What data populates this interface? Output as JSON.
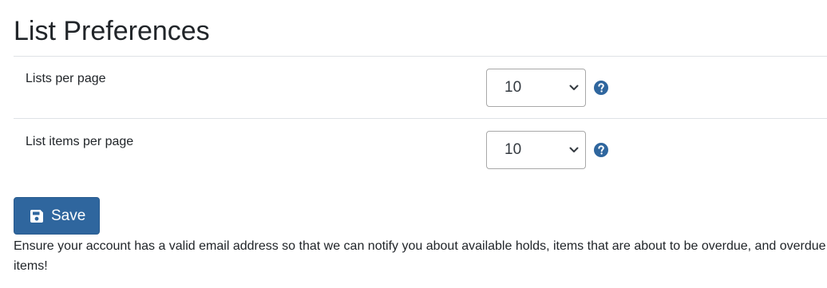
{
  "page": {
    "title": "List Preferences"
  },
  "preferences": [
    {
      "label": "Lists per page",
      "selected_value": "10",
      "help_icon": "question-circle-icon"
    },
    {
      "label": "List items per page",
      "selected_value": "10",
      "help_icon": "question-circle-icon"
    }
  ],
  "actions": {
    "save_label": "Save",
    "save_icon": "floppy-disk-icon"
  },
  "notice": "Ensure your account has a valid email address so that we can notify you about available holds, items that are about to be overdue, and overdue items!",
  "colors": {
    "primary": "#2f669e",
    "help_icon": "#2f669e",
    "divider": "#dee2e6",
    "text": "#212529"
  }
}
